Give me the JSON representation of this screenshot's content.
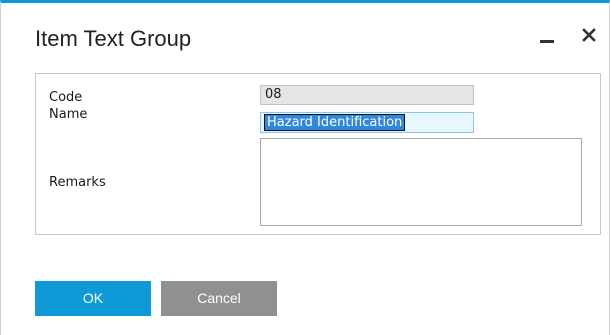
{
  "window": {
    "title": "Item Text Group",
    "accent_color": "#0e9ad7",
    "minimize_icon": "minimize-icon",
    "close_icon": "close-icon"
  },
  "form": {
    "code_label": "Code",
    "code_value": "08",
    "name_label": "Name",
    "name_value": "Hazard Identification",
    "remarks_label": "Remarks",
    "remarks_value": ""
  },
  "buttons": {
    "ok_label": "OK",
    "cancel_label": "Cancel"
  }
}
